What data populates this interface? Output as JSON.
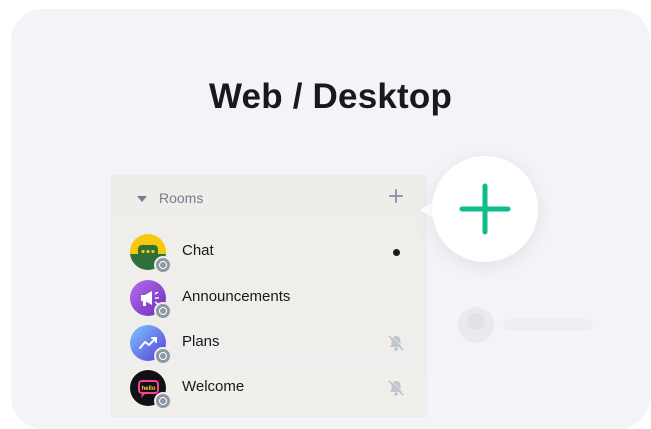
{
  "headline": "Web / Desktop",
  "section": {
    "label": "Rooms",
    "add_icon": "plus-icon"
  },
  "rooms": [
    {
      "name": "Chat",
      "avatar": "chat-avatar",
      "status": "unread-dot",
      "avatar_colors": [
        "#f6c90e",
        "#2e6f3b"
      ]
    },
    {
      "name": "Announcements",
      "avatar": "megaphone-avatar",
      "status": "none",
      "avatar_colors": [
        "#9b5de5",
        "#6a2fb8"
      ]
    },
    {
      "name": "Plans",
      "avatar": "chart-avatar",
      "status": "muted",
      "avatar_colors": [
        "#7aa2ff",
        "#5a3ad6"
      ]
    },
    {
      "name": "Welcome",
      "avatar": "hello-avatar",
      "status": "muted",
      "avatar_colors": [
        "#111111",
        "#ff3c9a"
      ]
    }
  ],
  "callout": {
    "icon": "plus-icon",
    "color": "#0dbd8b"
  },
  "colors": {
    "card_bg": "#f3f4f8",
    "text": "#17191c",
    "muted_text": "#737d8c",
    "accent": "#0dbd8b"
  }
}
